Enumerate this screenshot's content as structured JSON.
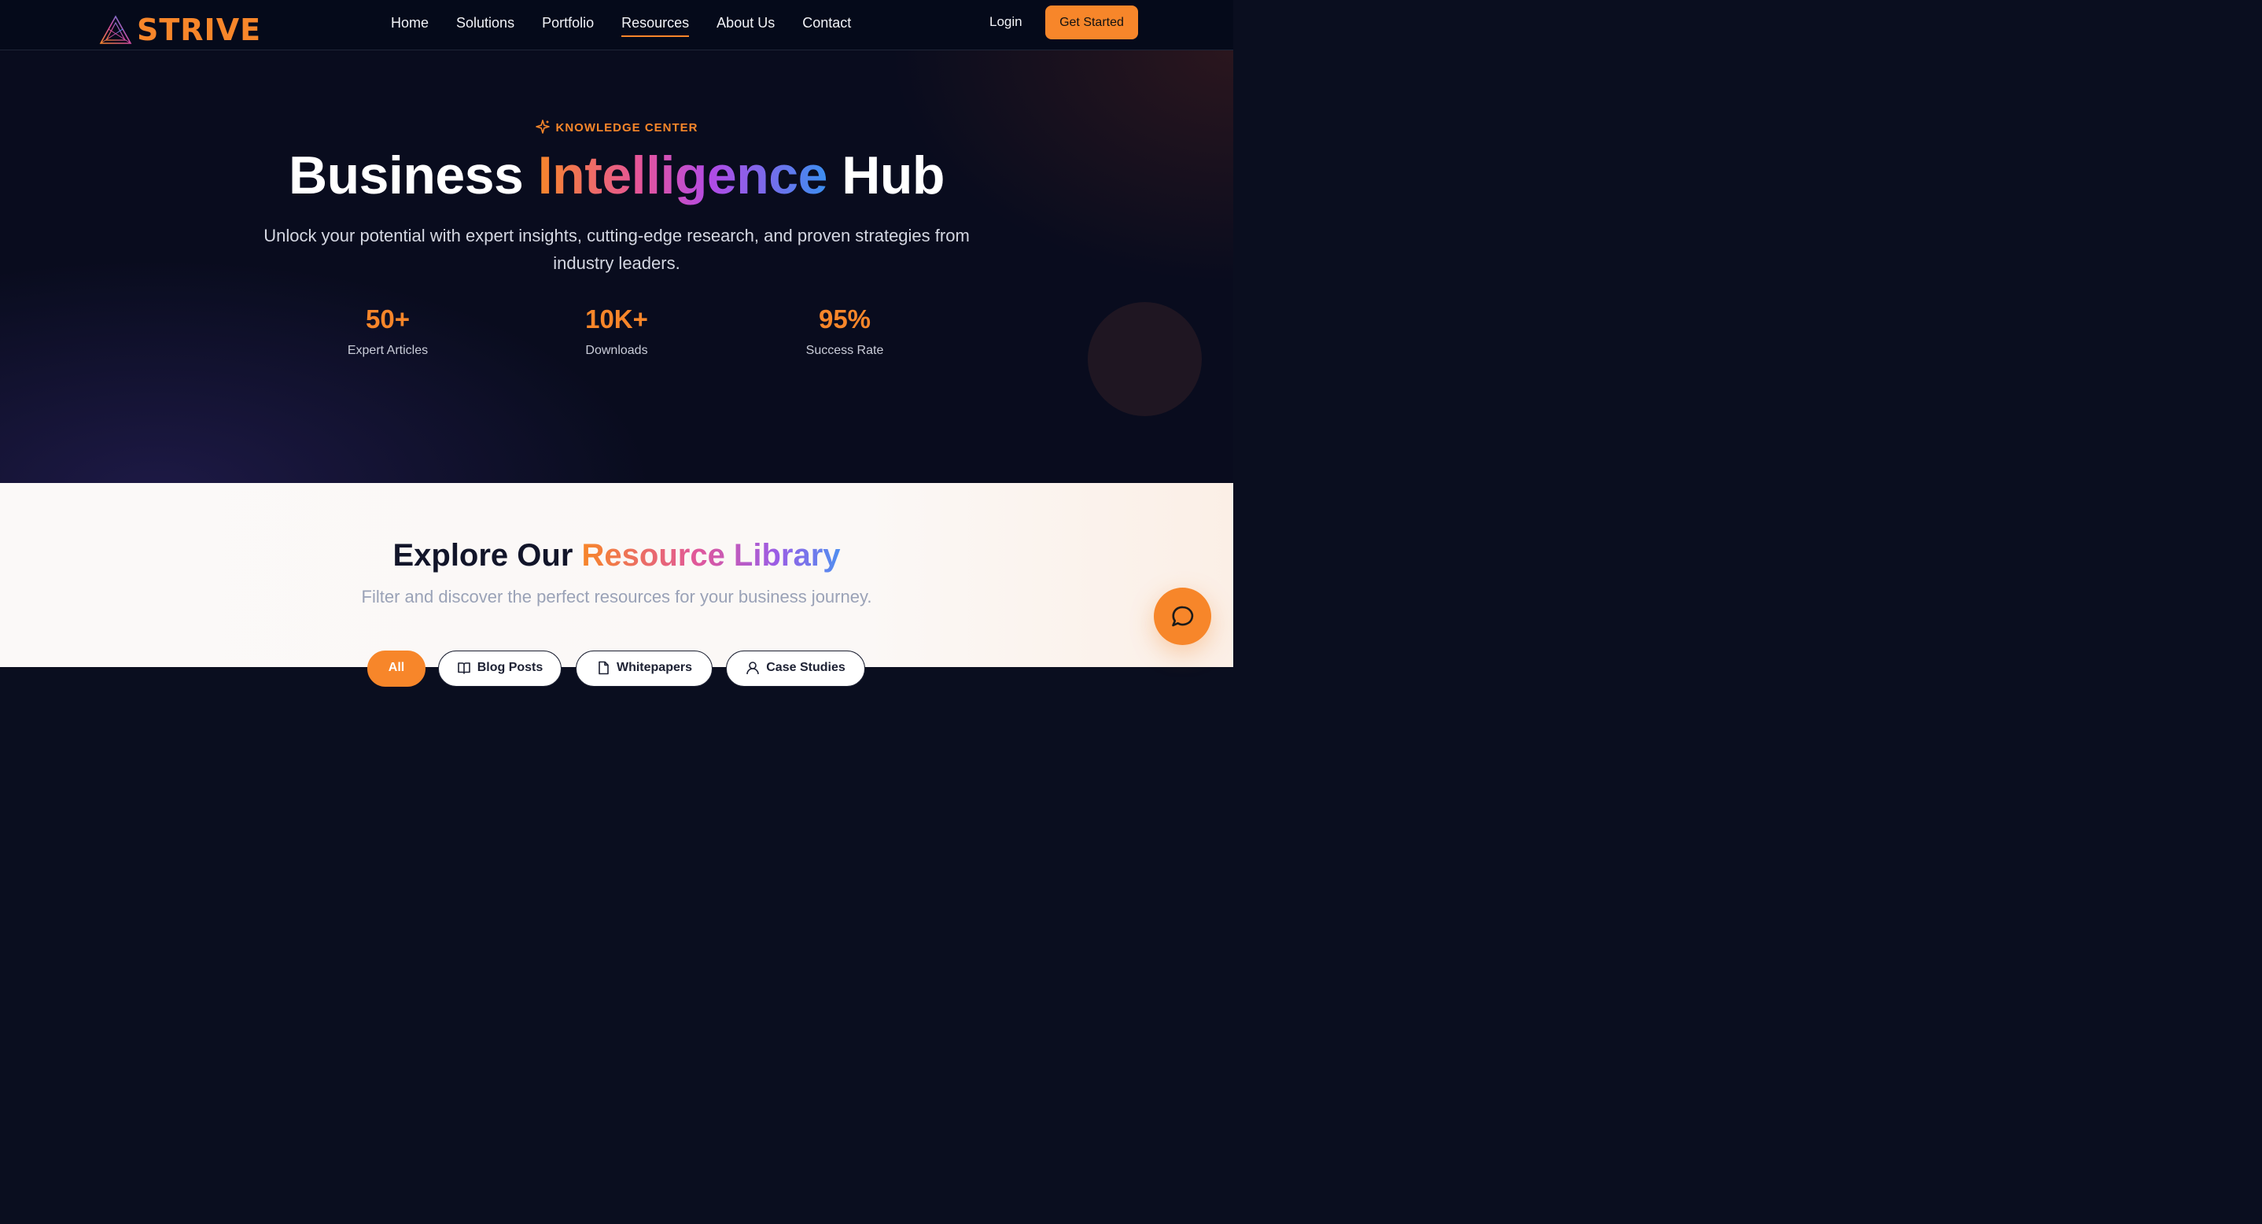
{
  "brand": {
    "name": "STRIVE",
    "logo_icon": "prism-triangle-icon",
    "color": "#f7862a"
  },
  "nav": {
    "items": [
      {
        "label": "Home",
        "active": false
      },
      {
        "label": "Solutions",
        "active": false
      },
      {
        "label": "Portfolio",
        "active": false
      },
      {
        "label": "Resources",
        "active": true
      },
      {
        "label": "About Us",
        "active": false
      },
      {
        "label": "Contact",
        "active": false
      }
    ],
    "login_label": "Login",
    "cta_label": "Get Started"
  },
  "hero": {
    "eyebrow": "KNOWLEDGE CENTER",
    "eyebrow_icon": "sparkle-icon",
    "title_start": "Business ",
    "title_highlight": "Intelligence",
    "title_end": " Hub",
    "subtitle_line1": "Unlock your potential with expert insights, cutting-edge research, and proven strategies from",
    "subtitle_line2": "industry leaders.",
    "stats": [
      {
        "value": "50+",
        "label": "Expert Articles"
      },
      {
        "value": "10K+",
        "label": "Downloads"
      },
      {
        "value": "95%",
        "label": "Success Rate"
      }
    ]
  },
  "library": {
    "title_start": "Explore Our ",
    "title_highlight": "Resource Library",
    "subtitle": "Filter and discover the perfect resources for your business journey.",
    "filters": [
      {
        "label": "All",
        "icon": "",
        "active": true
      },
      {
        "label": "Blog Posts",
        "icon": "book-open-icon",
        "active": false
      },
      {
        "label": "Whitepapers",
        "icon": "document-icon",
        "active": false
      },
      {
        "label": "Case Studies",
        "icon": "user-icon",
        "active": false
      }
    ]
  },
  "chat": {
    "icon": "chat-bubble-icon"
  },
  "colors": {
    "accent": "#f7862a",
    "nav_bg": "#050a1a",
    "hero_bg": "#090c1e",
    "light_bg": "#fbf9f8"
  }
}
